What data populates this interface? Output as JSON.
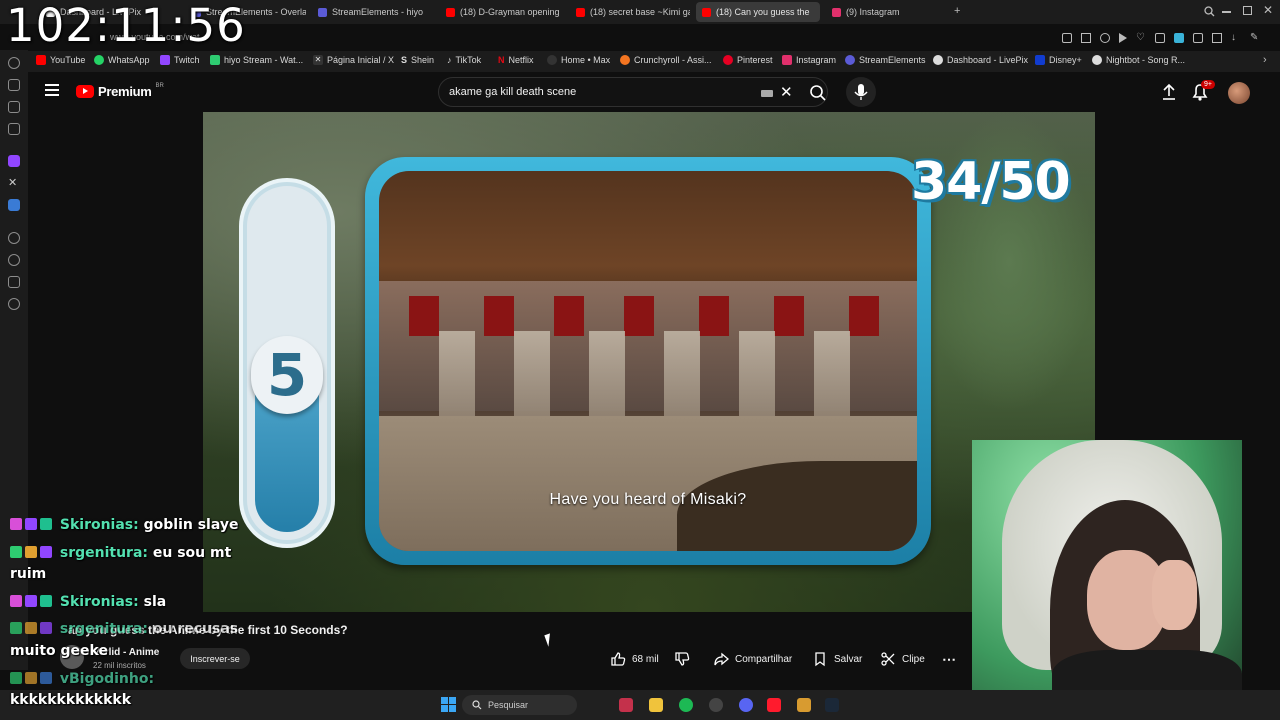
{
  "browser": {
    "tabs": [
      {
        "label": "Dashboard - LivePix",
        "color": "#ffffff"
      },
      {
        "label": "StreamElements - Overlay",
        "color": "#5b5bd6"
      },
      {
        "label": "StreamElements - hiyo",
        "color": "#5b5bd6"
      },
      {
        "label": "(18) D-Grayman opening",
        "color": "#ff0000"
      },
      {
        "label": "(18) secret base ~Kimi ga",
        "color": "#ff0000"
      },
      {
        "label": "(18) Can you guess the",
        "color": "#ff0000"
      },
      {
        "label": "(9) Instagram",
        "color": "#e1306c"
      }
    ],
    "url_partial": "www.youtube.com/wat",
    "new_tab_label": "+"
  },
  "bookmarks": [
    {
      "label": "YouTube",
      "color": "#ff0000"
    },
    {
      "label": "WhatsApp",
      "color": "#25d366"
    },
    {
      "label": "Twitch",
      "color": "#9146ff"
    },
    {
      "label": "hiyo Stream - Wat...",
      "color": "#2ecc71"
    },
    {
      "label": "Página Inicial / X",
      "color": "#dddddd"
    },
    {
      "label": "Shein",
      "color": "#dddddd"
    },
    {
      "label": "TikTok",
      "color": "#dddddd"
    },
    {
      "label": "Netflix",
      "color": "#e50914"
    },
    {
      "label": "Home • Max",
      "color": "#dddddd"
    },
    {
      "label": "Crunchyroll - Assi...",
      "color": "#f47521"
    },
    {
      "label": "Pinterest",
      "color": "#e60023"
    },
    {
      "label": "Instagram",
      "color": "#e1306c"
    },
    {
      "label": "StreamElements",
      "color": "#5b5bd6"
    },
    {
      "label": "Dashboard - LivePix",
      "color": "#dddddd"
    },
    {
      "label": "Disney+",
      "color": "#113ccf"
    },
    {
      "label": "Nightbot - Song R...",
      "color": "#dddddd"
    }
  ],
  "overlay": {
    "clock": "102:11:56"
  },
  "youtube": {
    "logo": "Premium",
    "logo_country": "BR",
    "search_value": "akame ga kill death scene",
    "notification_count": "9+"
  },
  "video": {
    "timer_number": "5",
    "counter": "34/50",
    "caption": "Have you heard of Misaki?",
    "title": "an you guess the Anime by the first 10 Seconds?",
    "channel_name": "Verlid - Anime",
    "channel_subs": "22 mil inscritos",
    "subscribe_label": "Inscrever-se",
    "like_count": "68 mil",
    "share_label": "Compartilhar",
    "save_label": "Salvar",
    "clip_label": "Clipe"
  },
  "chat": [
    {
      "user": "Skironias:",
      "message": "goblin slaye"
    },
    {
      "user": "srgenitura:",
      "message": "eu sou mt"
    },
    {
      "user": "",
      "message": "ruim"
    },
    {
      "user": "Skironias:",
      "message": "sla"
    },
    {
      "user": "srgenitura:",
      "message": "ou recusas"
    },
    {
      "user": "",
      "message": "muito geeke"
    },
    {
      "user": "vBigodinho:",
      "message": ""
    },
    {
      "user": "",
      "message": "kkkkkkkkkkkkk"
    }
  ],
  "taskbar": {
    "search_placeholder": "Pesquisar"
  },
  "colors": {
    "accent": "#ff0000",
    "chat_user": "#53e0b0",
    "frame": "#2ea3cc"
  }
}
